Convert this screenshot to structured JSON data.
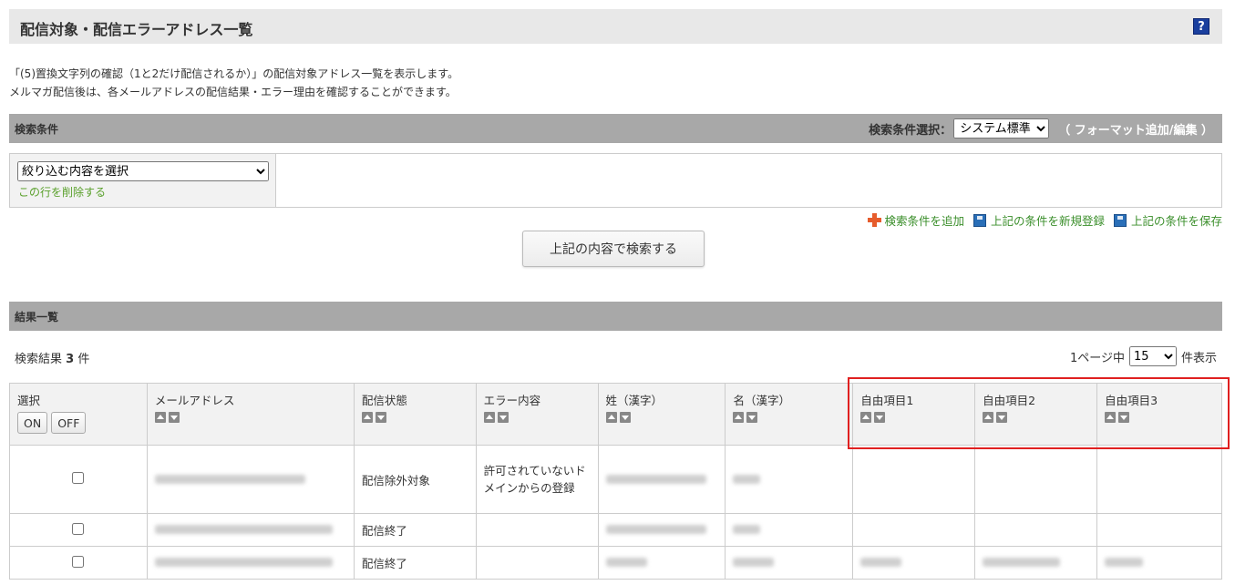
{
  "page": {
    "title": "配信対象・配信エラーアドレス一覧",
    "help_label": "?",
    "description_line1": "「(5)置換文字列の確認（1と2だけ配信されるか）」の配信対象アドレス一覧を表示します。",
    "description_line2": "メルマガ配信後は、各メールアドレスの配信結果・エラー理由を確認することができます。"
  },
  "search": {
    "section_label": "検索条件",
    "condition_select_label": "検索条件選択：",
    "condition_select_value": "システム標準",
    "format_link": "（ フォーマット追加/編集 ）",
    "filter_select_value": "絞り込む内容を選択",
    "delete_row_label": "この行を削除する",
    "add_condition_label": "検索条件を追加",
    "register_new_label": "上記の条件を新規登録",
    "save_condition_label": "上記の条件を保存",
    "search_button_label": "上記の内容で検索する"
  },
  "results": {
    "section_label": "結果一覧",
    "count_prefix": "検索結果",
    "count_value": "3",
    "count_suffix": "件",
    "per_page_prefix": "1ページ中",
    "per_page_value": "15",
    "per_page_suffix": "件表示",
    "columns": {
      "select": "選択",
      "on": "ON",
      "off": "OFF",
      "email": "メールアドレス",
      "status": "配信状態",
      "error": "エラー内容",
      "last_name": "姓（漢字）",
      "first_name": "名（漢字）",
      "free1": "自由項目1",
      "free2": "自由項目2",
      "free3": "自由項目3"
    },
    "rows": [
      {
        "status": "配信除外対象",
        "error": "許可されていないドメインからの登録"
      },
      {
        "status": "配信終了",
        "error": ""
      },
      {
        "status": "配信終了",
        "error": ""
      }
    ]
  },
  "colors": {
    "accent_green": "#3a8e2a",
    "highlight_red": "#e02020",
    "section_gray": "#a8a8a8"
  }
}
